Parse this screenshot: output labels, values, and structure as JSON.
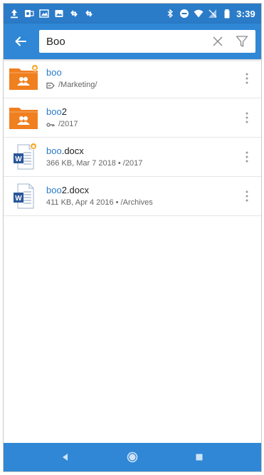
{
  "status_bar": {
    "time": "3:39",
    "left_icons": [
      "upload-icon",
      "outlook-icon",
      "gallery-icon",
      "image-icon",
      "sync-icon",
      "sync-icon"
    ],
    "right_icons": [
      "bluetooth-icon",
      "do-not-disturb-icon",
      "wifi-icon",
      "no-sim-icon",
      "battery-icon"
    ]
  },
  "search": {
    "value": "Boo",
    "placeholder": ""
  },
  "results": [
    {
      "highlight": "boo",
      "rest": "",
      "sub_icon": "tag-icon",
      "subtitle": "/Marketing/",
      "icon": "shared-folder-icon",
      "starred": true
    },
    {
      "highlight": "boo",
      "rest": "2",
      "sub_icon": "key-icon",
      "subtitle": "/2017",
      "icon": "shared-folder-icon",
      "starred": false
    },
    {
      "highlight": "boo",
      "rest": ".docx",
      "sub_icon": "",
      "subtitle": "366 KB, Mar 7 2018 • /2017",
      "icon": "word-doc-icon",
      "starred": true
    },
    {
      "highlight": "boo",
      "rest": "2.docx",
      "sub_icon": "",
      "subtitle": "411 KB, Apr 4 2016  • /Archives",
      "icon": "word-doc-icon",
      "starred": false
    }
  ],
  "colors": {
    "status_bar": "#2a7bc8",
    "app_bar": "#2f87d6",
    "folder": "#f07f1f",
    "highlight": "#2a7bc8",
    "word": "#2b579a",
    "star": "#f5a623"
  },
  "nav_bar": {
    "icons": [
      "back-triangle-icon",
      "home-circle-icon",
      "recents-square-icon"
    ]
  }
}
